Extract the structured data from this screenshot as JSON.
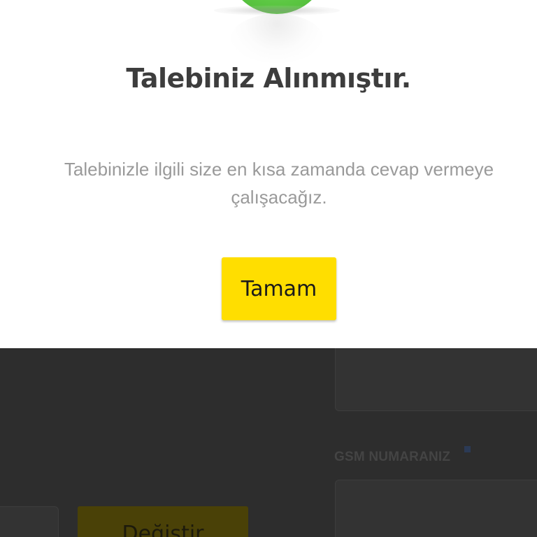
{
  "modal": {
    "title": "Talebiniz Alınmıştır.",
    "message": "Talebinizle ilgili size en kısa zamanda cevap vermeye çalışacağız.",
    "ok_button_label": "Tamam",
    "icon": "success-check-circle-icon"
  },
  "background_form": {
    "gsm_label": "GSM NUMARANIZ",
    "partial_button_label": "Değiştir"
  },
  "colors": {
    "accent_yellow": "#ffde00",
    "success_green": "#5cc743",
    "overlay_dark": "#2d2d2d",
    "title_text": "#3d3d3d",
    "message_text": "#9a9a9a"
  }
}
